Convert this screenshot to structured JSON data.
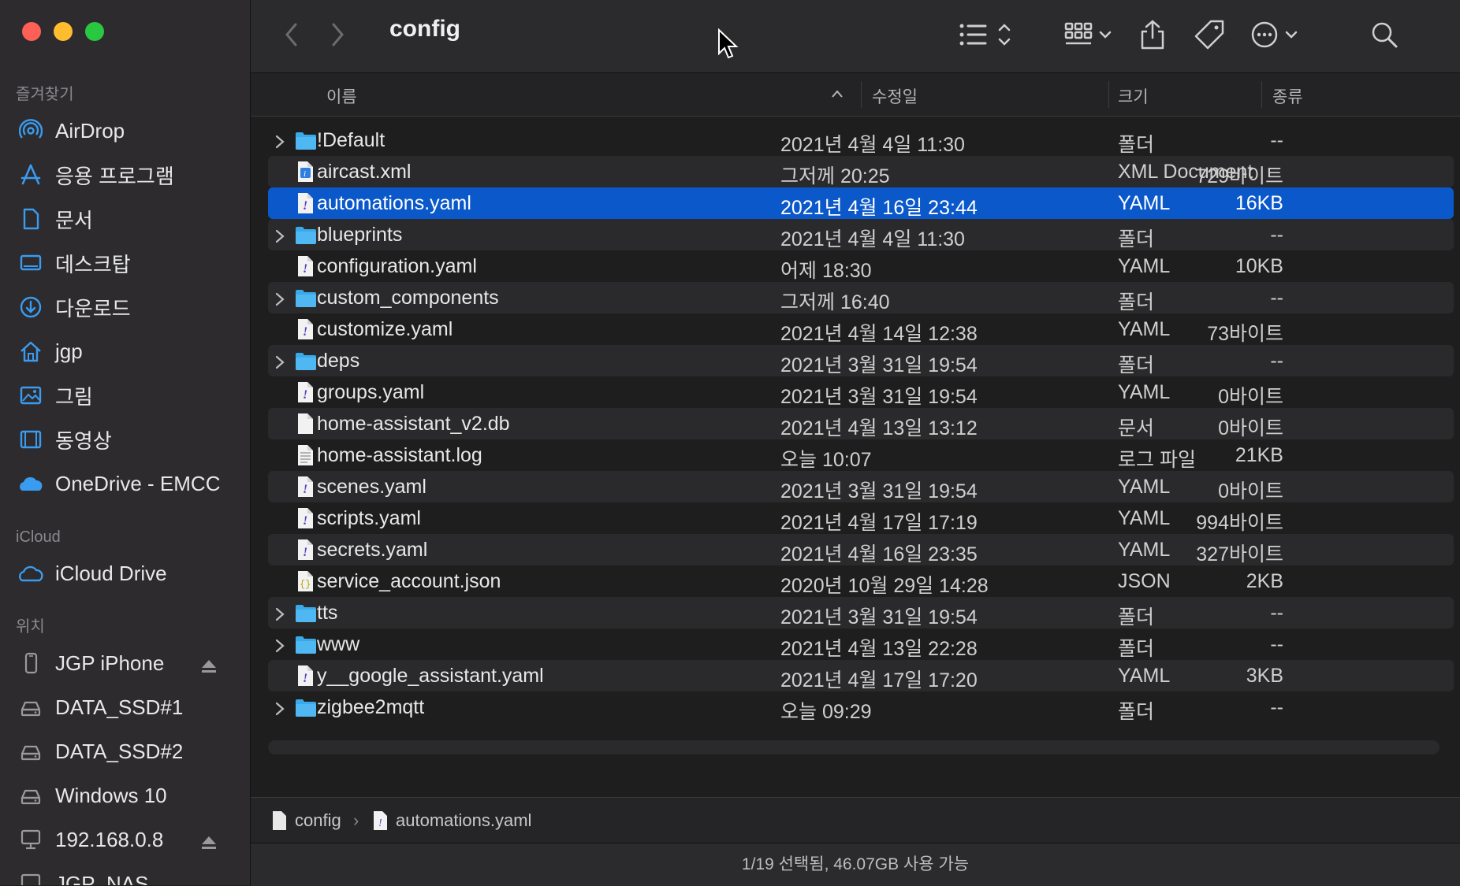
{
  "window": {
    "title": "config"
  },
  "colors": {
    "accent": "#0a58ca",
    "folder": "#3aa9e8",
    "close": "#fe5f57",
    "minimize": "#febc2e",
    "zoom": "#28c840"
  },
  "sidebar": {
    "favorites_title": "즐겨찾기",
    "favorites": [
      {
        "label": "AirDrop",
        "icon": "airdrop-icon"
      },
      {
        "label": "응용 프로그램",
        "icon": "applications-icon"
      },
      {
        "label": "문서",
        "icon": "document-icon"
      },
      {
        "label": "데스크탑",
        "icon": "desktop-icon"
      },
      {
        "label": "다운로드",
        "icon": "download-icon"
      },
      {
        "label": "jgp",
        "icon": "home-icon"
      },
      {
        "label": "그림",
        "icon": "pictures-icon"
      },
      {
        "label": "동영상",
        "icon": "movies-icon"
      },
      {
        "label": "OneDrive - EMCC",
        "icon": "onedrive-icon"
      }
    ],
    "icloud_title": "iCloud",
    "icloud": [
      {
        "label": "iCloud Drive",
        "icon": "icloud-icon"
      }
    ],
    "locations_title": "위치",
    "locations": [
      {
        "label": "JGP iPhone",
        "icon": "iphone-icon"
      },
      {
        "label": "DATA_SSD#1",
        "icon": "disk-icon"
      },
      {
        "label": "DATA_SSD#2",
        "icon": "disk-icon"
      },
      {
        "label": "Windows 10",
        "icon": "disk-icon"
      },
      {
        "label": "192.168.0.8",
        "icon": "network-computer-icon"
      },
      {
        "label": "JGP_NAS",
        "icon": "network-computer-icon"
      }
    ]
  },
  "columns": {
    "name": "이름",
    "modified": "수정일",
    "size": "크기",
    "kind": "종류"
  },
  "files": [
    {
      "name": "!Default",
      "date": "2021년 4월 4일 11:30",
      "size": "--",
      "kind": "폴더",
      "type": "folder"
    },
    {
      "name": "aircast.xml",
      "date": "그저께 20:25",
      "size": "729바이트",
      "kind": "XML Document",
      "type": "xml"
    },
    {
      "name": "automations.yaml",
      "date": "2021년 4월 16일 23:44",
      "size": "16KB",
      "kind": "YAML",
      "type": "yaml",
      "selected": true
    },
    {
      "name": "blueprints",
      "date": "2021년 4월 4일 11:30",
      "size": "--",
      "kind": "폴더",
      "type": "folder"
    },
    {
      "name": "configuration.yaml",
      "date": "어제 18:30",
      "size": "10KB",
      "kind": "YAML",
      "type": "yaml"
    },
    {
      "name": "custom_components",
      "date": "그저께 16:40",
      "size": "--",
      "kind": "폴더",
      "type": "folder"
    },
    {
      "name": "customize.yaml",
      "date": "2021년 4월 14일 12:38",
      "size": "73바이트",
      "kind": "YAML",
      "type": "yaml"
    },
    {
      "name": "deps",
      "date": "2021년 3월 31일 19:54",
      "size": "--",
      "kind": "폴더",
      "type": "folder"
    },
    {
      "name": "groups.yaml",
      "date": "2021년 3월 31일 19:54",
      "size": "0바이트",
      "kind": "YAML",
      "type": "yaml"
    },
    {
      "name": "home-assistant_v2.db",
      "date": "2021년 4월 13일 13:12",
      "size": "0바이트",
      "kind": "문서",
      "type": "doc"
    },
    {
      "name": "home-assistant.log",
      "date": "오늘 10:07",
      "size": "21KB",
      "kind": "로그 파일",
      "type": "log"
    },
    {
      "name": "scenes.yaml",
      "date": "2021년 3월 31일 19:54",
      "size": "0바이트",
      "kind": "YAML",
      "type": "yaml"
    },
    {
      "name": "scripts.yaml",
      "date": "2021년 4월 17일 17:19",
      "size": "994바이트",
      "kind": "YAML",
      "type": "yaml"
    },
    {
      "name": "secrets.yaml",
      "date": "2021년 4월 16일 23:35",
      "size": "327바이트",
      "kind": "YAML",
      "type": "yaml"
    },
    {
      "name": "service_account.json",
      "date": "2020년 10월 29일 14:28",
      "size": "2KB",
      "kind": "JSON",
      "type": "json"
    },
    {
      "name": "tts",
      "date": "2021년 3월 31일 19:54",
      "size": "--",
      "kind": "폴더",
      "type": "folder"
    },
    {
      "name": "www",
      "date": "2021년 4월 13일 22:28",
      "size": "--",
      "kind": "폴더",
      "type": "folder"
    },
    {
      "name": "y__google_assistant.yaml",
      "date": "2021년 4월 17일 17:20",
      "size": "3KB",
      "kind": "YAML",
      "type": "yaml"
    },
    {
      "name": "zigbee2mqtt",
      "date": "오늘 09:29",
      "size": "--",
      "kind": "폴더",
      "type": "folder"
    }
  ],
  "pathbar": {
    "folder": "config",
    "separator": "›",
    "file": "automations.yaml"
  },
  "status": {
    "text": "1/19 선택됨, 46.07GB 사용 가능"
  }
}
